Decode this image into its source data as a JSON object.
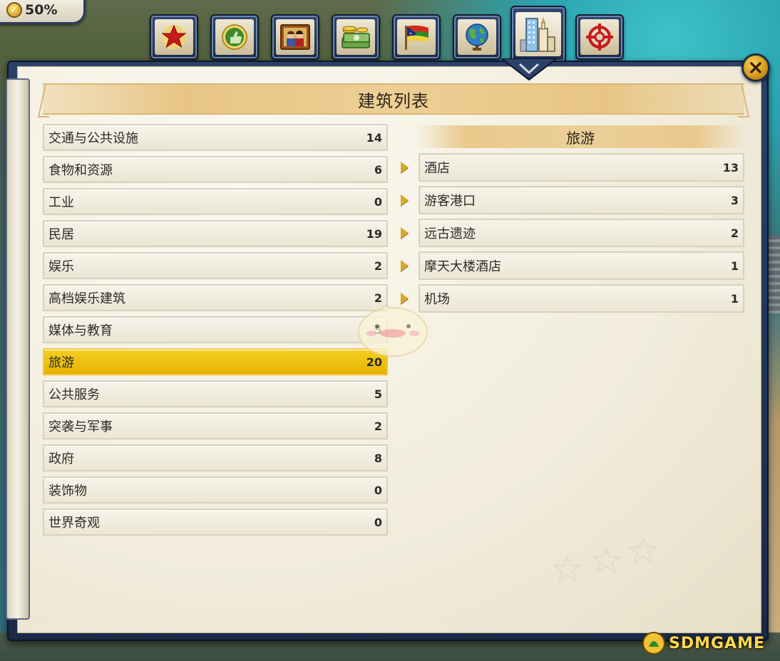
{
  "hud": {
    "progress_label": "50%"
  },
  "tabs": [
    {
      "name": "almanac-tab",
      "icon": "red-star-icon",
      "active": false
    },
    {
      "name": "approval-tab",
      "icon": "thumbs-up-icon",
      "active": false
    },
    {
      "name": "people-tab",
      "icon": "portrait-icon",
      "active": false
    },
    {
      "name": "economy-tab",
      "icon": "money-icon",
      "active": false
    },
    {
      "name": "diplomacy-tab",
      "icon": "flag-icon",
      "active": false
    },
    {
      "name": "world-tab",
      "icon": "globe-icon",
      "active": false
    },
    {
      "name": "buildings-tab",
      "icon": "buildings-icon",
      "active": true
    },
    {
      "name": "missions-tab",
      "icon": "crosshair-icon",
      "active": false
    }
  ],
  "panel": {
    "title": "建筑列表",
    "categories": [
      {
        "label": "交通与公共设施",
        "count": "14"
      },
      {
        "label": "食物和资源",
        "count": "6"
      },
      {
        "label": "工业",
        "count": "0"
      },
      {
        "label": "民居",
        "count": "19"
      },
      {
        "label": "娱乐",
        "count": "2"
      },
      {
        "label": "高档娱乐建筑",
        "count": "2"
      },
      {
        "label": "媒体与教育",
        "count": "5"
      },
      {
        "label": "旅游",
        "count": "20",
        "selected": true
      },
      {
        "label": "公共服务",
        "count": "5"
      },
      {
        "label": "突袭与军事",
        "count": "2"
      },
      {
        "label": "政府",
        "count": "8"
      },
      {
        "label": "装饰物",
        "count": "0"
      },
      {
        "label": "世界奇观",
        "count": "0"
      }
    ],
    "subcategory_title": "旅游",
    "subcategories": [
      {
        "label": "酒店",
        "count": "13"
      },
      {
        "label": "游客港口",
        "count": "3"
      },
      {
        "label": "远古遗迹",
        "count": "2"
      },
      {
        "label": "摩天大楼酒店",
        "count": "1"
      },
      {
        "label": "机场",
        "count": "1"
      }
    ]
  },
  "watermark": {
    "text": "SDMGAME"
  },
  "colors": {
    "selected_row": "#f5cf23",
    "panel_frame": "#2b4169",
    "paper": "#f1ecdc",
    "arrow": "#d9a92a"
  }
}
